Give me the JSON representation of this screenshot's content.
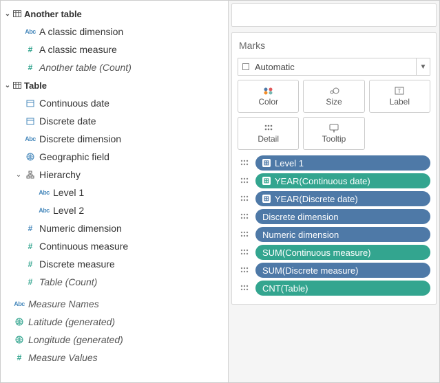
{
  "data_pane": {
    "tables": [
      {
        "name": "Another table",
        "fields": [
          {
            "label": "A classic dimension",
            "icon": "abc",
            "role": "dim"
          },
          {
            "label": "A classic measure",
            "icon": "hash",
            "role": "meas"
          },
          {
            "label": "Another table (Count)",
            "icon": "hash",
            "role": "meas",
            "italic": true
          }
        ]
      },
      {
        "name": "Table",
        "fields": [
          {
            "label": "Continuous date",
            "icon": "cal",
            "role": "dim"
          },
          {
            "label": "Discrete date",
            "icon": "cal",
            "role": "dim"
          },
          {
            "label": "Discrete dimension",
            "icon": "abc",
            "role": "dim"
          },
          {
            "label": "Geographic field",
            "icon": "globe",
            "role": "dim"
          },
          {
            "label": "Hierarchy",
            "icon": "hier",
            "role": "dim",
            "expandable": true,
            "children": [
              {
                "label": "Level 1",
                "icon": "abc",
                "role": "dim"
              },
              {
                "label": "Level 2",
                "icon": "abc",
                "role": "dim"
              }
            ]
          },
          {
            "label": "Numeric dimension",
            "icon": "hash",
            "role": "dim_num"
          },
          {
            "label": "Continuous measure",
            "icon": "hash",
            "role": "meas"
          },
          {
            "label": "Discrete measure",
            "icon": "hash",
            "role": "meas"
          },
          {
            "label": "Table (Count)",
            "icon": "hash",
            "role": "meas",
            "italic": true
          }
        ]
      }
    ],
    "extras": [
      {
        "label": "Measure Names",
        "icon": "abc",
        "italic": true
      },
      {
        "label": "Latitude (generated)",
        "icon": "globe",
        "role": "meas",
        "italic": true
      },
      {
        "label": "Longitude (generated)",
        "icon": "globe",
        "role": "meas",
        "italic": true
      },
      {
        "label": "Measure Values",
        "icon": "hash",
        "role": "meas",
        "italic": true
      }
    ]
  },
  "marks": {
    "title": "Marks",
    "mark_type": "Automatic",
    "buttons": {
      "color": "Color",
      "size": "Size",
      "label": "Label",
      "detail": "Detail",
      "tooltip": "Tooltip"
    },
    "pills": [
      {
        "text": "Level 1",
        "color": "blue",
        "plus": true
      },
      {
        "text": "YEAR(Continuous date)",
        "color": "green",
        "plus": true
      },
      {
        "text": "YEAR(Discrete date)",
        "color": "blue",
        "plus": true
      },
      {
        "text": "Discrete dimension",
        "color": "blue",
        "plus": false
      },
      {
        "text": "Numeric dimension",
        "color": "blue",
        "plus": false
      },
      {
        "text": "SUM(Continuous measure)",
        "color": "green",
        "plus": false
      },
      {
        "text": "SUM(Discrete measure)",
        "color": "blue",
        "plus": false
      },
      {
        "text": "CNT(Table)",
        "color": "green",
        "plus": false
      }
    ]
  }
}
